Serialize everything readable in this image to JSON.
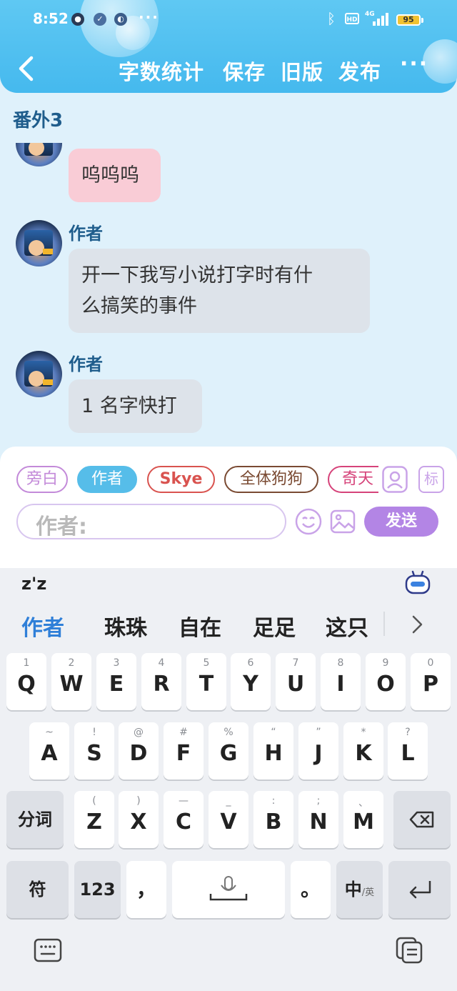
{
  "status_bar": {
    "time": "8:52",
    "more": "···",
    "hd": "HD",
    "network": "4G",
    "battery": "95"
  },
  "header": {
    "buttons": [
      "字数统计",
      "保存",
      "旧版",
      "发布"
    ],
    "more": "···"
  },
  "chat": {
    "title": "番外3",
    "messages": [
      {
        "sender": "",
        "text": "呜呜呜"
      },
      {
        "sender": "作者",
        "text_line1": "开一下我写小说打字时有什",
        "text_line2": "么搞笑的事件"
      },
      {
        "sender": "作者",
        "text": "1 名字快打"
      }
    ]
  },
  "composer": {
    "roles": [
      "旁白",
      "作者",
      "Skye",
      "全体狗狗",
      "奇天"
    ],
    "selected_role": "作者",
    "role_colors": [
      "#c38ad9",
      "#56bde9",
      "#d9534f",
      "#7a4a32",
      "#d6437a"
    ],
    "tag_label": "标",
    "input_placeholder": "作者:",
    "send_label": "发送"
  },
  "keyboard": {
    "pinyin": "z'z",
    "candidates": [
      "作者",
      "珠珠",
      "自在",
      "足足",
      "这只"
    ],
    "row1": [
      {
        "hint": "1",
        "key": "Q"
      },
      {
        "hint": "2",
        "key": "W"
      },
      {
        "hint": "3",
        "key": "E"
      },
      {
        "hint": "4",
        "key": "R"
      },
      {
        "hint": "5",
        "key": "T"
      },
      {
        "hint": "6",
        "key": "Y"
      },
      {
        "hint": "7",
        "key": "U"
      },
      {
        "hint": "8",
        "key": "I"
      },
      {
        "hint": "9",
        "key": "O"
      },
      {
        "hint": "0",
        "key": "P"
      }
    ],
    "row2": [
      {
        "hint": "~",
        "key": "A"
      },
      {
        "hint": "!",
        "key": "S"
      },
      {
        "hint": "@",
        "key": "D"
      },
      {
        "hint": "#",
        "key": "F"
      },
      {
        "hint": "%",
        "key": "G"
      },
      {
        "hint": "“",
        "key": "H"
      },
      {
        "hint": "”",
        "key": "J"
      },
      {
        "hint": "*",
        "key": "K"
      },
      {
        "hint": "?",
        "key": "L"
      }
    ],
    "row3": [
      {
        "hint": "(",
        "key": "Z"
      },
      {
        "hint": ")",
        "key": "X"
      },
      {
        "hint": "—",
        "key": "C"
      },
      {
        "hint": "_",
        "key": "V"
      },
      {
        "hint": ":",
        "key": "B"
      },
      {
        "hint": ";",
        "key": "N"
      },
      {
        "hint": "、",
        "key": "M"
      }
    ],
    "fenci": "分词",
    "symbols": "符",
    "numbers": "123",
    "comma": "，",
    "period": "。",
    "lang_main": "中",
    "lang_sub": "/英"
  }
}
